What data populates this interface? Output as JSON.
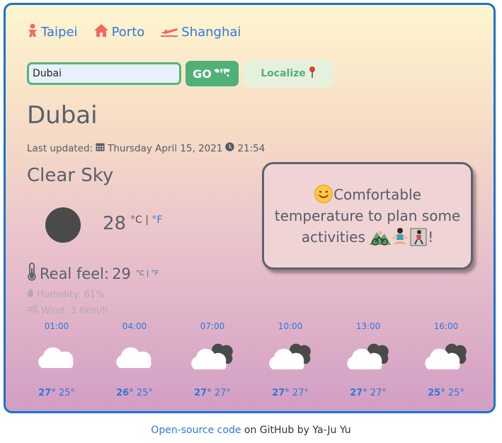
{
  "nav": {
    "cities": [
      {
        "label": "Taipei",
        "icon": "baby-icon"
      },
      {
        "label": "Porto",
        "icon": "home-icon"
      },
      {
        "label": "Shanghai",
        "icon": "plane-icon"
      }
    ]
  },
  "search": {
    "value": "Dubai",
    "go_label": "GO",
    "localize_label": "Localize"
  },
  "current": {
    "city": "Dubai",
    "updated_label": "Last updated:",
    "date": "Thursday April 15, 2021",
    "time": "21:54",
    "condition": "Clear Sky",
    "temp": "28",
    "unit_c": "°C",
    "unit_sep": " | ",
    "unit_f": "°F",
    "feel_label": "Real feel:",
    "feel_temp": "29",
    "humidity": "Humidity: 61%",
    "wind": "Wind: 3.6km/h"
  },
  "message": {
    "text_1": "Comfortable temperature to plan some activities ",
    "text_2": "!"
  },
  "forecast": [
    {
      "time": "01:00",
      "high": "27°",
      "low": "25°",
      "icon": "cloud-icon"
    },
    {
      "time": "04:00",
      "high": "26°",
      "low": "25°",
      "icon": "cloud-icon"
    },
    {
      "time": "07:00",
      "high": "27°",
      "low": "27°",
      "icon": "cloudy-icon"
    },
    {
      "time": "10:00",
      "high": "27°",
      "low": "27°",
      "icon": "cloudy-icon"
    },
    {
      "time": "13:00",
      "high": "27°",
      "low": "27°",
      "icon": "cloudy-icon"
    },
    {
      "time": "16:00",
      "high": "25°",
      "low": "25°",
      "icon": "cloudy-icon"
    }
  ],
  "footer": {
    "link": "Open-source code",
    "rest": " on GitHub by Ya-Ju Yu"
  }
}
